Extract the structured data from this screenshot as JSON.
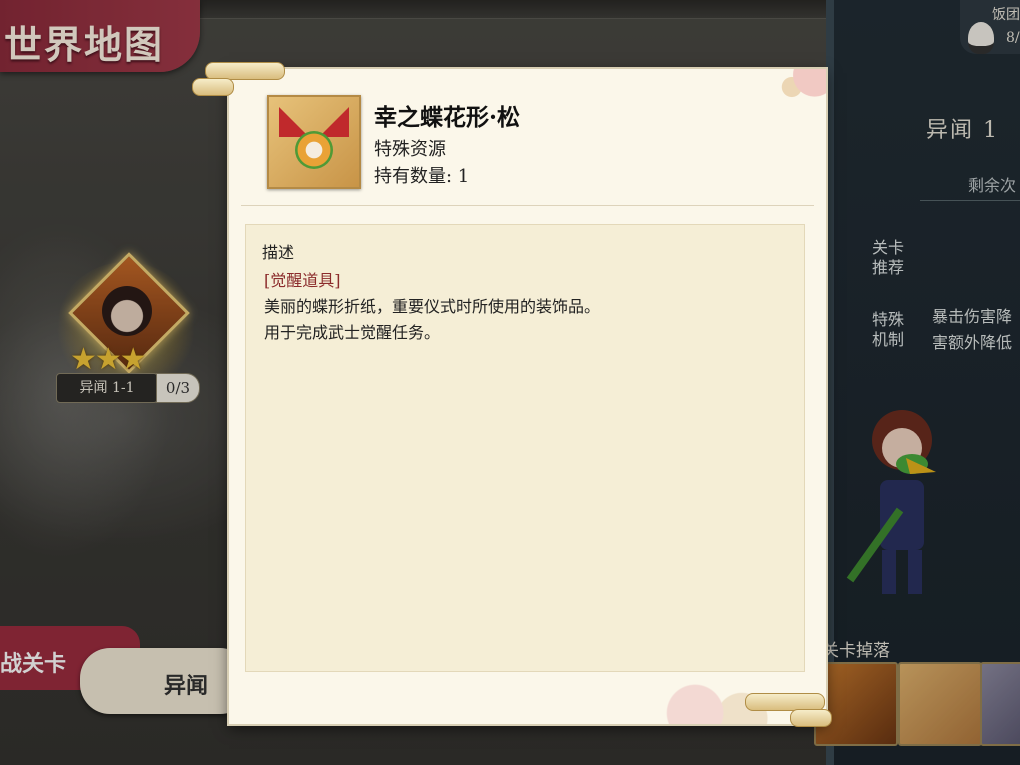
{
  "map": {
    "title": "世界地图"
  },
  "stage_node": {
    "name": "异闻 1-1",
    "progress": "0/3",
    "stars": 3
  },
  "buttons": {
    "left_red": "战关卡",
    "left_cream": "异闻"
  },
  "right_panel": {
    "food_label": "饭团",
    "food_count": "8/",
    "stage_title": "异闻 1",
    "remaining": "剩余次",
    "tag_recommend": "关卡\n推荐",
    "tag_mechanic": "特殊\n机制",
    "mechanic_text": "暴击伤害降\n害额外降低",
    "drops_label": "关卡掉落"
  },
  "item_popup": {
    "name": "幸之蝶花形·松",
    "type": "特殊资源",
    "count_label": "持有数量: 1",
    "desc_heading": "描述",
    "desc_tag": "[觉醒道具]",
    "desc_line1": "美丽的蝶形折纸，重要仪式时所使用的装饰品。",
    "desc_line2": "用于完成武士觉醒任务。"
  },
  "colors": {
    "accent_red": "#9c2c3f",
    "panel_cream": "#fbf7ea",
    "desc_bg": "#f5eed6",
    "tag_red": "#8b2b2b"
  }
}
